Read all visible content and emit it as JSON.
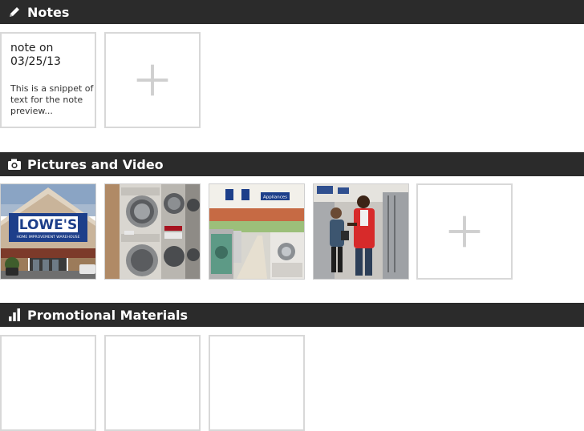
{
  "sections": {
    "notes": {
      "title": "Notes",
      "icon": "pencil-icon"
    },
    "pictures": {
      "title": "Pictures and Video",
      "icon": "camera-icon"
    },
    "promo": {
      "title": "Promotional Materials",
      "icon": "bar-chart-icon"
    }
  },
  "notes": {
    "items": [
      {
        "title": "note on 03/25/13",
        "snippet": "This is a snippet of text  for the note preview..."
      }
    ],
    "add_icon": "plus-icon"
  },
  "pictures": {
    "items": [
      {
        "name": "lowes-storefront-photo",
        "sign_text": "LOWE'S",
        "sign_subtext": "HOME IMPROVEMENT WAREHOUSE"
      },
      {
        "name": "washers-dryers-photo"
      },
      {
        "name": "appliances-aisle-photo",
        "sign_text": "Appliances"
      },
      {
        "name": "staff-helping-customer-photo"
      }
    ],
    "add_icon": "plus-icon"
  },
  "promo": {
    "count": 3
  },
  "colors": {
    "header_bg": "#2b2b2b",
    "header_text": "#ffffff",
    "tile_border": "#d8d8d8",
    "plus": "#cfcfcf",
    "lowes_blue": "#1d3f8a"
  }
}
